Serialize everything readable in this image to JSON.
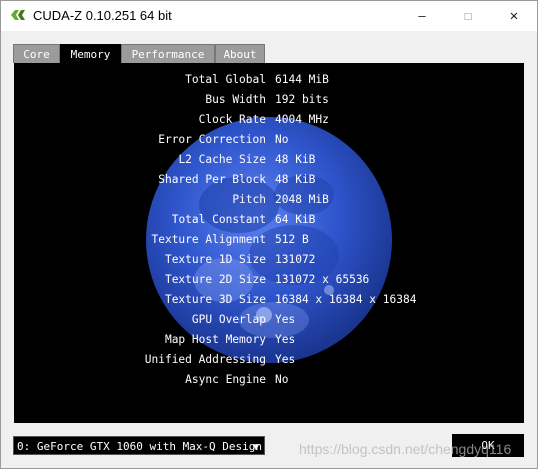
{
  "window": {
    "title": "CUDA-Z 0.10.251 64 bit",
    "minimize_glyph": "—",
    "maximize_glyph": "☐",
    "close_glyph": "✕"
  },
  "tabs": [
    {
      "label": "Core",
      "active": false
    },
    {
      "label": "Memory",
      "active": true
    },
    {
      "label": "Performance",
      "active": false
    },
    {
      "label": "About",
      "active": false
    }
  ],
  "memory": {
    "rows": [
      {
        "label": "Total Global",
        "value": "6144 MiB"
      },
      {
        "label": "Bus Width",
        "value": "192 bits"
      },
      {
        "label": "Clock Rate",
        "value": "4004 MHz"
      },
      {
        "label": "Error Correction",
        "value": "No"
      },
      {
        "label": "L2 Cache Size",
        "value": "48 KiB"
      },
      {
        "label": "Shared Per Block",
        "value": "48 KiB"
      },
      {
        "label": "Pitch",
        "value": "2048 MiB"
      },
      {
        "label": "Total Constant",
        "value": "64 KiB"
      },
      {
        "label": "Texture Alignment",
        "value": "512 B"
      },
      {
        "label": "Texture 1D Size",
        "value": "131072"
      },
      {
        "label": "Texture 2D Size",
        "value": "131072 x 65536"
      },
      {
        "label": "Texture 3D Size",
        "value": "16384 x 16384 x 16384"
      },
      {
        "label": "GPU Overlap",
        "value": "Yes"
      },
      {
        "label": "Map Host Memory",
        "value": "Yes"
      },
      {
        "label": "Unified Addressing",
        "value": "Yes"
      },
      {
        "label": "Async Engine",
        "value": "No"
      }
    ]
  },
  "footer": {
    "device_selected": "0: GeForce GTX 1060 with Max-Q Design",
    "device_arrow": "▼",
    "ok_label": "OK",
    "watermark": "https://blog.csdn.net/chengdyq116"
  },
  "colors": {
    "panel_bg": "#000000",
    "moon": "#2a4fc8",
    "tab_inactive": "#9b9b9b",
    "tab_active": "#000000"
  },
  "icons": {
    "app": "cuda-z-logo-icon"
  }
}
